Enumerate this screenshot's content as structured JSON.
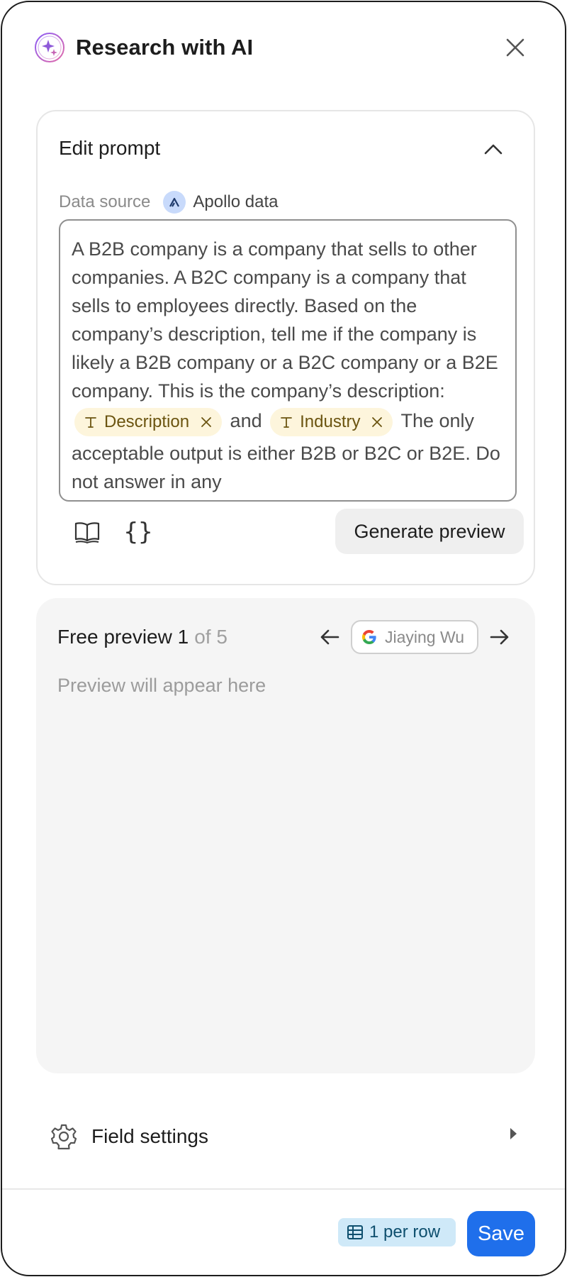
{
  "header": {
    "title": "Research with AI"
  },
  "edit_prompt": {
    "title": "Edit prompt",
    "data_source_label": "Data source",
    "data_source_value": "Apollo data",
    "prompt_segments": [
      "A B2B company is a company that sells to other companies. A B2C company is a company that sells to employees directly. Based on the company’s description, tell me if the company is likely a B2B company or a B2C company or a B2E company. This is the company’s description: ",
      " and ",
      " The only acceptable output is either B2B or B2C or B2E. Do not answer in any"
    ],
    "chips": [
      "Description",
      "Industry"
    ],
    "generate_label": "Generate preview"
  },
  "preview": {
    "title": "Free preview 1",
    "of_label": "of 5",
    "record_name": "Jiaying Wu",
    "placeholder": "Preview will appear here"
  },
  "settings": {
    "label": "Field settings"
  },
  "footer": {
    "badge_label": "1 per row",
    "save_label": "Save"
  },
  "colors": {
    "accent": "#1f6feb",
    "chip_bg": "#fdf5dc",
    "chip_text": "#6b5410",
    "badge_bg": "#cfe9f8",
    "preview_bg": "#f5f5f5"
  },
  "icons": [
    "ai-sparkle-icon",
    "close-icon",
    "chevron-up-icon",
    "apollo-logo-icon",
    "text-type-icon",
    "remove-icon",
    "book-icon",
    "braces-icon",
    "arrow-left-icon",
    "google-icon",
    "arrow-right-icon",
    "gear-icon",
    "caret-right-icon",
    "table-icon"
  ]
}
